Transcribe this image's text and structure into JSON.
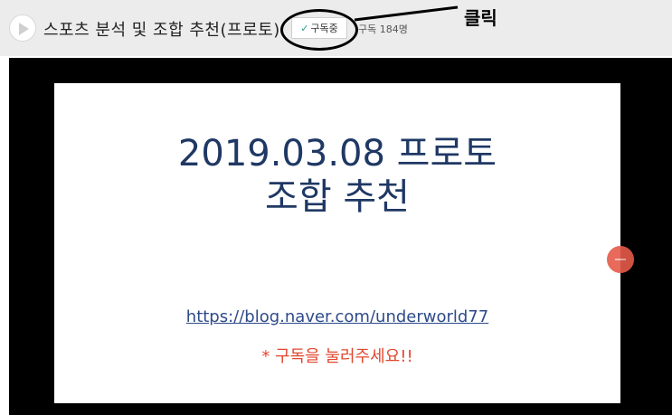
{
  "header": {
    "channel_title": "스포츠 분석 및 조합 추천(프로토)",
    "subscribe_label": "구독중",
    "subscriber_count": "구독 184명"
  },
  "annotation": {
    "label": "클릭"
  },
  "slide": {
    "title_line1": "2019.03.08 프로토",
    "title_line2": "조합 추천",
    "link": "https://blog.naver.com/underworld77",
    "note": "* 구독을 눌러주세요!!"
  },
  "colors": {
    "title": "#1f3864",
    "note": "#e0482f",
    "header_bg": "#ececec"
  }
}
